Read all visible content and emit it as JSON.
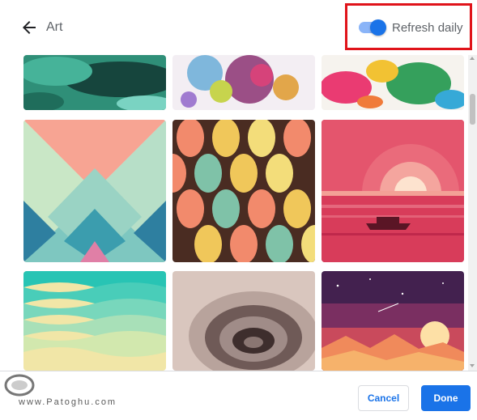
{
  "header": {
    "title": "Art",
    "toggle_label": "Refresh daily",
    "toggle_on": true
  },
  "tiles": [
    {
      "name": "tile-teal-watercolor",
      "row": 0,
      "col": 0
    },
    {
      "name": "tile-splash-watercolor",
      "row": 0,
      "col": 1
    },
    {
      "name": "tile-colorful-splash",
      "row": 0,
      "col": 2
    },
    {
      "name": "tile-geometric-pastel",
      "row": 1,
      "col": 0
    },
    {
      "name": "tile-leaf-pattern",
      "row": 1,
      "col": 1
    },
    {
      "name": "tile-pink-sunset-boat",
      "row": 1,
      "col": 2
    },
    {
      "name": "tile-teal-waves",
      "row": 2,
      "col": 0
    },
    {
      "name": "tile-swirl-sepia",
      "row": 2,
      "col": 1
    },
    {
      "name": "tile-purple-sunset-mountains",
      "row": 2,
      "col": 2
    }
  ],
  "footer": {
    "cancel_label": "Cancel",
    "done_label": "Done"
  },
  "watermark": {
    "text": "www.Patoghu.com"
  },
  "colors": {
    "accent": "#1a73e8",
    "highlight_border": "#e0131a"
  }
}
